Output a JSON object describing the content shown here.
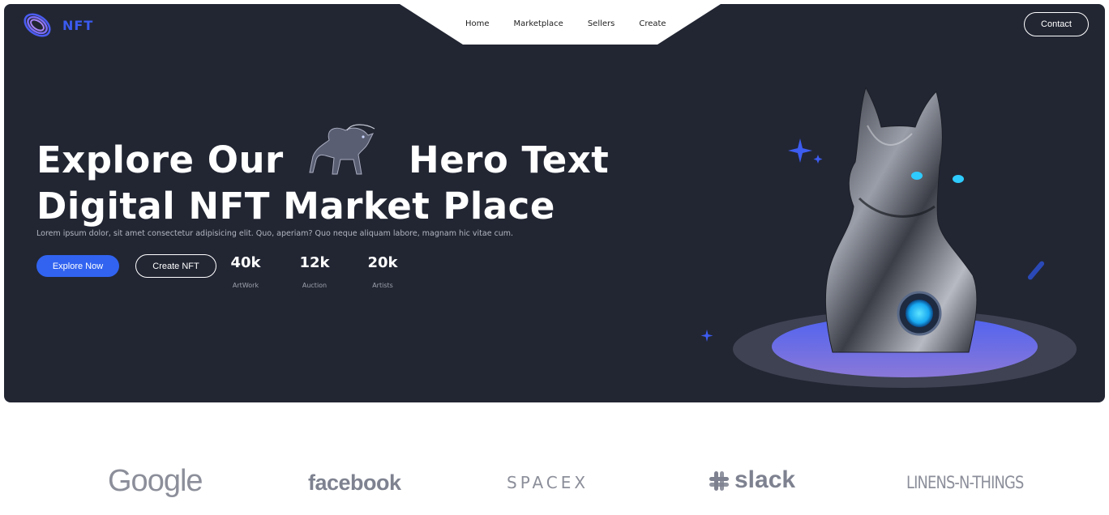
{
  "brand": {
    "name": "NFT",
    "accent": "#3163f0",
    "hero_bg": "#222633"
  },
  "nav": {
    "items": [
      "Home",
      "Marketplace",
      "Sellers",
      "Create"
    ],
    "contact_label": "Contact"
  },
  "hero": {
    "title_line1_a": "Explore Our",
    "title_line1_b": "Hero Text",
    "title_line2": "Digital NFT Market Place",
    "description": "Lorem ipsum dolor, sit amet consectetur adipisicing elit. Quo, aperiam? Quo neque aliquam labore, magnam hic vitae cum.",
    "explore_label": "Explore Now",
    "create_label": "Create NFT",
    "stats": [
      {
        "value": "40k",
        "label": "ArtWork"
      },
      {
        "value": "12k",
        "label": "Auction"
      },
      {
        "value": "20k",
        "label": "Artists"
      }
    ]
  },
  "partners": {
    "google": "Google",
    "facebook": "facebook",
    "spacex": "SPACEX",
    "slack": "slack",
    "linens": "LINENS-N-THINGS"
  }
}
